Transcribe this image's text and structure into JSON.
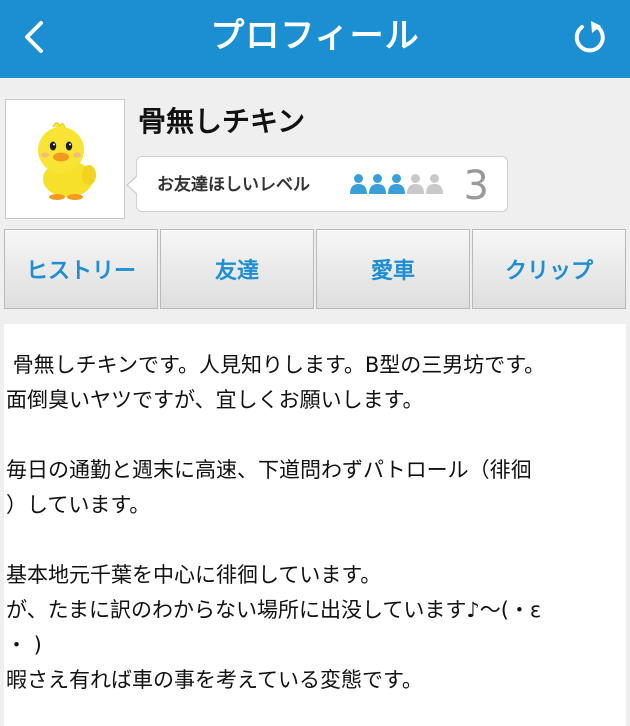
{
  "header": {
    "title": "プロフィール",
    "back_icon": "chevron-left-icon",
    "refresh_icon": "refresh-icon"
  },
  "profile": {
    "username": "骨無しチキン",
    "avatar_icon": "chick-avatar",
    "level_label": "お友達ほしいレベル",
    "level_value": "3",
    "level_max": 5,
    "level_on_color": "#3a9fd8",
    "level_off_color": "#c9c9c9"
  },
  "tabs": [
    {
      "label": "ヒストリー"
    },
    {
      "label": "友達"
    },
    {
      "label": "愛車"
    },
    {
      "label": "クリップ"
    }
  ],
  "bio": {
    "lines": [
      " 骨無しチキンです。人見知りします。B型の三男坊です。",
      "面倒臭いヤツですが、宜しくお願いします。",
      "",
      "毎日の通勤と週末に高速、下道問わずパトロール（徘徊",
      "）しています。",
      "",
      "基本地元千葉を中心に徘徊しています。",
      "が、たまに訳のわからない場所に出没しています♪〜(・ε",
      "・ )",
      "暇さえ有れば車の事を考えている変態です。"
    ]
  },
  "colors": {
    "header_bg": "#1b8fd1",
    "tab_text": "#1d8ed2"
  }
}
